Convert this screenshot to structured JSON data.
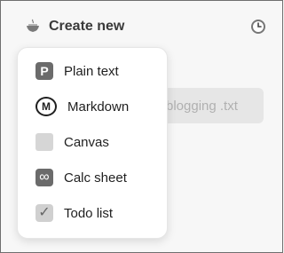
{
  "header": {
    "title": "Create new",
    "icon": "bowl-icon",
    "clock_icon": "clock-icon"
  },
  "background": {
    "file_label": "blogging .txt"
  },
  "menu": {
    "items": [
      {
        "label": "Plain text",
        "icon": "plain-text-icon",
        "glyph": "P"
      },
      {
        "label": "Markdown",
        "icon": "markdown-icon",
        "glyph": "M"
      },
      {
        "label": "Canvas",
        "icon": "canvas-icon"
      },
      {
        "label": "Calc sheet",
        "icon": "infinity-icon",
        "glyph": "∞"
      },
      {
        "label": "Todo list",
        "icon": "checkbox-icon",
        "glyph": "✓"
      }
    ]
  }
}
